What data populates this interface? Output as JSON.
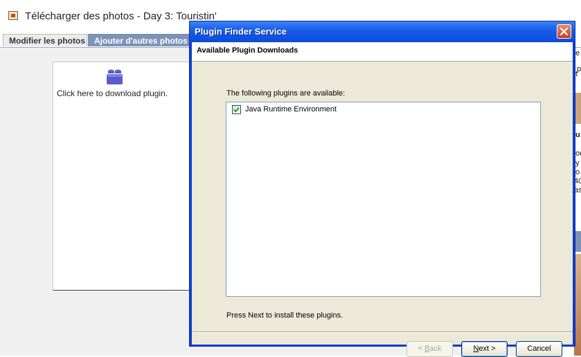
{
  "page": {
    "title": "Télécharger des photos - Day 3: Touristin'",
    "tabs": [
      {
        "label": "Modifier les photos"
      },
      {
        "label": "Ajouter d'autres photos"
      }
    ],
    "plugin_box": {
      "text": "Click here to download plugin."
    },
    "right_panel_fragments": [
      "e",
      "p",
      "t",
      "u",
      "ou",
      "y",
      "o",
      "40",
      "as"
    ]
  },
  "dialog": {
    "title": "Plugin Finder Service",
    "header": "Available Plugin Downloads",
    "available_label": "The following plugins are available:",
    "plugins": [
      {
        "label": "Java Runtime Environment",
        "checked": true
      }
    ],
    "instruction": "Press Next to install these plugins.",
    "buttons": {
      "back": {
        "arrow": "< ",
        "mnemonic": "B",
        "rest": "ack",
        "enabled": false
      },
      "next": {
        "mnemonic": "N",
        "rest": "ext",
        "arrow": " >"
      },
      "cancel": "Cancel"
    }
  },
  "colors": {
    "titlebar": "#0c4bdc",
    "dialog_body": "#ece9d8",
    "active_tab": "#7f93b7",
    "close_button": "#c8401c"
  },
  "icons": [
    "page-photo-icon",
    "plugin-lego-icon",
    "close-icon",
    "checkmark-icon"
  ]
}
